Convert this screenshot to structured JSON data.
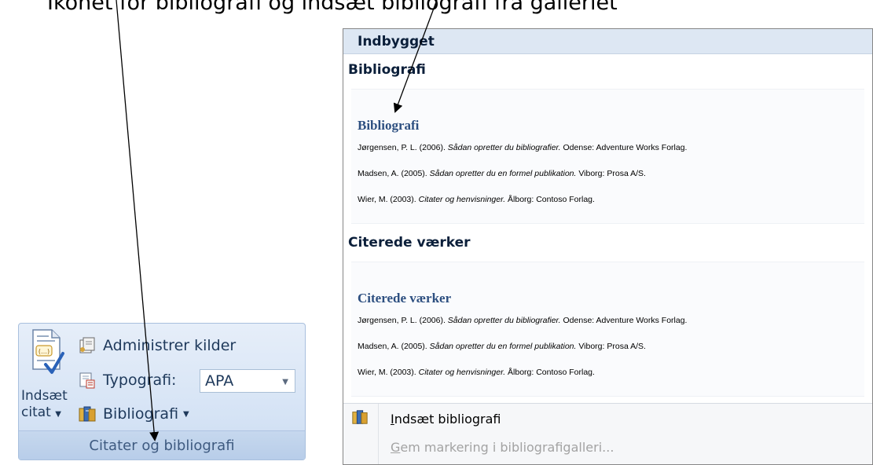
{
  "caption": "Ikonet for bibliografi og indsæt bibliografi fra galleriet",
  "ribbon": {
    "insert_citation": {
      "line1": "Indsæt",
      "line2": "citat",
      "arrow": "▼",
      "icon": "insert-citation-icon"
    },
    "manage_sources": {
      "label": "Administrer kilder",
      "icon": "manage-sources-icon"
    },
    "style": {
      "label": "Typografi:",
      "value": "APA",
      "icon": "style-icon"
    },
    "bibliography": {
      "label": "Bibliografi",
      "arrow": "▼",
      "icon": "bibliography-icon"
    },
    "group_title": "Citater og bibliografi",
    "colors": {
      "group_bg": "#d5e3f5",
      "text": "#1e395b"
    }
  },
  "gallery": {
    "header": "Indbygget",
    "sections": [
      {
        "label": "Bibliografi",
        "preview_title": "Bibliografi",
        "entries": [
          {
            "pre": "Jørgensen, P. L. (2006). ",
            "title": "Sådan opretter du bibliografier.",
            "post": " Odense: Adventure Works Forlag."
          },
          {
            "pre": "Madsen, A. (2005). ",
            "title": "Sådan opretter du en formel publikation.",
            "post": " Viborg: Prosa A/S."
          },
          {
            "pre": "Wier, M. (2003). ",
            "title": "Citater og henvisninger.",
            "post": " Ålborg: Contoso Forlag."
          }
        ]
      },
      {
        "label": "Citerede værker",
        "preview_title": "Citerede værker",
        "entries": [
          {
            "pre": "Jørgensen, P. L. (2006). ",
            "title": "Sådan opretter du bibliografier.",
            "post": " Odense: Adventure Works Forlag."
          },
          {
            "pre": "Madsen, A. (2005). ",
            "title": "Sådan opretter du en formel publikation.",
            "post": " Viborg: Prosa A/S."
          },
          {
            "pre": "Wier, M. (2003). ",
            "title": "Citater og henvisninger.",
            "post": " Ålborg: Contoso Forlag."
          }
        ]
      }
    ],
    "footer": {
      "insert": {
        "accel": "I",
        "rest": "ndsæt bibliografi"
      },
      "save": {
        "accel": "G",
        "rest": "em markering i bibliografigalleri..."
      }
    },
    "colors": {
      "header_bg": "#dde7f3",
      "title_blue": "#2d4f80",
      "disabled": "#a3a3a3"
    }
  }
}
